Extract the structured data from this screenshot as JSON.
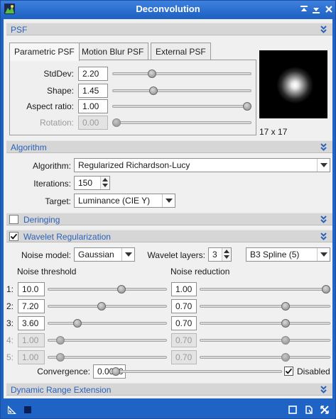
{
  "window": {
    "title": "Deconvolution"
  },
  "sections": {
    "psf": "PSF",
    "algorithm": "Algorithm",
    "deringing": "Deringing",
    "wavelet": "Wavelet Regularization",
    "dynamic": "Dynamic Range Extension"
  },
  "psf": {
    "tabs": [
      "Parametric PSF",
      "Motion Blur PSF",
      "External PSF"
    ],
    "active_tab": "Parametric PSF",
    "stddev_label": "StdDev:",
    "stddev": "2.20",
    "stddev_level": 0.27,
    "shape_label": "Shape:",
    "shape": "1.45",
    "shape_level": 0.28,
    "aspect_label": "Aspect ratio:",
    "aspect": "1.00",
    "aspect_level": 1.0,
    "rotation_label": "Rotation:",
    "rotation": "0.00",
    "rotation_level": 0.0,
    "preview_size": "17 x 17"
  },
  "algorithm": {
    "algorithm_label": "Algorithm:",
    "algorithm": "Regularized Richardson-Lucy",
    "iterations_label": "Iterations:",
    "iterations": "150",
    "target_label": "Target:",
    "target": "Luminance (CIE Y)"
  },
  "deringing": {
    "checked": false
  },
  "wavelet": {
    "checked": true,
    "noise_model_label": "Noise model:",
    "noise_model": "Gaussian",
    "layers_label": "Wavelet layers:",
    "layers": "3",
    "scaling": "B3 Spline (5)",
    "noise_threshold_label": "Noise threshold",
    "noise_reduction_label": "Noise reduction",
    "rows": [
      {
        "label": "1:",
        "threshold": "10.0",
        "t_level": 0.63,
        "reduction": "1.00",
        "r_level": 1.0,
        "enabled": true
      },
      {
        "label": "2:",
        "threshold": "7.20",
        "t_level": 0.45,
        "reduction": "0.70",
        "r_level": 0.67,
        "enabled": true
      },
      {
        "label": "3:",
        "threshold": "3.60",
        "t_level": 0.23,
        "reduction": "0.70",
        "r_level": 0.67,
        "enabled": true
      },
      {
        "label": "4:",
        "threshold": "1.00",
        "t_level": 0.08,
        "reduction": "0.70",
        "r_level": 0.67,
        "enabled": false
      },
      {
        "label": "5:",
        "threshold": "1.00",
        "t_level": 0.08,
        "reduction": "0.70",
        "r_level": 0.67,
        "enabled": false
      }
    ],
    "convergence_label": "Convergence:",
    "convergence": "0.0000",
    "convergence_level": 0.0,
    "disabled_label": "Disabled",
    "disabled_checked": true
  },
  "colors": {
    "accent": "#2c61b8",
    "titlebar": "#1f62c2",
    "panel": "#f0f0f0"
  },
  "icons": {
    "app": "deconvolution-app-icon",
    "title_buttons": [
      "pin-icon",
      "shade-icon",
      "close-icon"
    ],
    "footer_left": [
      "new-instance-icon",
      "apply-global-icon"
    ],
    "footer_right": [
      "preview-icon",
      "documentation-icon",
      "reset-icon"
    ]
  }
}
